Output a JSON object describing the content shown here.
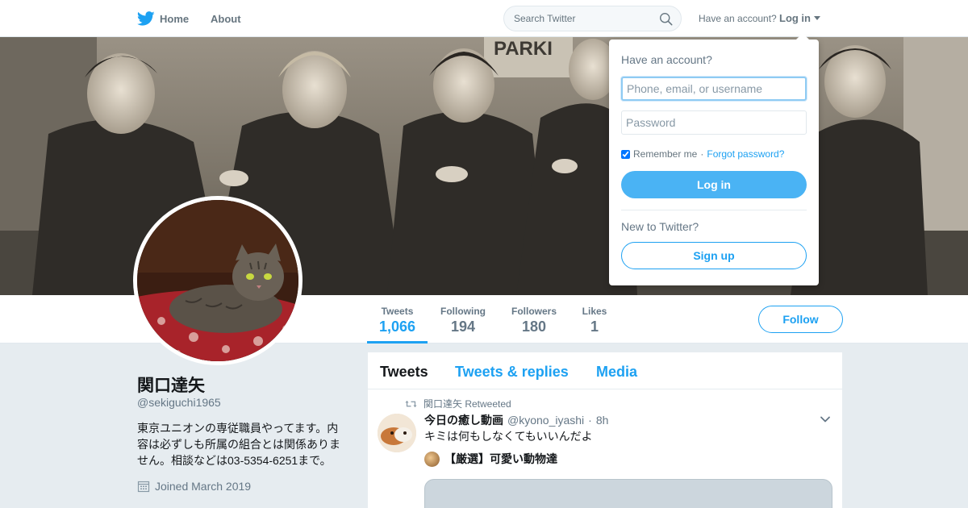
{
  "nav": {
    "home_label": "Home",
    "about_label": "About",
    "search_placeholder": "Search Twitter",
    "have_account": "Have an account?",
    "login_label": "Log in"
  },
  "profile": {
    "name": "関口達矢",
    "handle": "@sekiguchi1965",
    "bio": "東京ユニオンの専従職員やってます。内容は必ずしも所属の組合とは関係ありません。相談などは03-5354-6251まで。",
    "joined": "Joined March 2019",
    "follow_label": "Follow"
  },
  "stats": [
    {
      "label": "Tweets",
      "value": "1,066",
      "active": true
    },
    {
      "label": "Following",
      "value": "194",
      "active": false
    },
    {
      "label": "Followers",
      "value": "180",
      "active": false
    },
    {
      "label": "Likes",
      "value": "1",
      "active": false
    }
  ],
  "timeline": {
    "tabs": [
      {
        "label": "Tweets",
        "active": true
      },
      {
        "label": "Tweets & replies",
        "active": false
      },
      {
        "label": "Media",
        "active": false
      }
    ],
    "tweet": {
      "retweet_line": "関口達矢 Retweeted",
      "name": "今日の癒し動画",
      "handle": "@kyono_iyashi",
      "separator": "·",
      "time": "8h",
      "text": "キミは何もしなくてもいいんだよ",
      "link_text": "【厳選】可愛い動物達"
    }
  },
  "login_dropdown": {
    "title": "Have an account?",
    "username_placeholder": "Phone, email, or username",
    "password_placeholder": "Password",
    "remember_label": "Remember me",
    "separator": "·",
    "forgot_label": "Forgot password?",
    "login_button": "Log in",
    "new_label": "New to Twitter?",
    "signup_button": "Sign up"
  },
  "colors": {
    "brand_blue": "#1da1f2",
    "login_button": "#4ab3f4",
    "background": "#e6ecf0"
  }
}
